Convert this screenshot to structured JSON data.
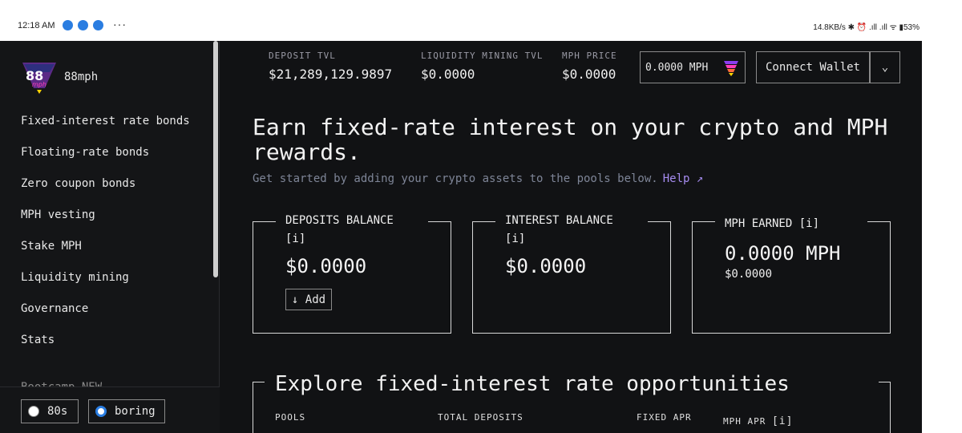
{
  "status_bar": {
    "time": "12:18 AM",
    "more": "···",
    "right": "14.8KB/s ✱ ⏰ .ıll .ıll ᯤ ▮53%"
  },
  "sidebar": {
    "brand": "88mph",
    "items": [
      {
        "label": "Fixed-interest rate bonds"
      },
      {
        "label": "Floating-rate bonds"
      },
      {
        "label": "Zero coupon bonds"
      },
      {
        "label": "MPH vesting"
      },
      {
        "label": "Stake MPH"
      },
      {
        "label": "Liquidity mining"
      },
      {
        "label": "Governance"
      },
      {
        "label": "Stats"
      }
    ],
    "cut_item": "Bootcamp NEW",
    "themes": [
      {
        "label": "80s",
        "selected": false
      },
      {
        "label": "boring",
        "selected": true
      }
    ]
  },
  "header": {
    "deposit_tvl_label": "DEPOSIT TVL",
    "deposit_tvl_value": "$21,289,129.9897",
    "lm_tvl_label": "LIQUIDITY MINING TVL",
    "lm_tvl_value": "$0.0000",
    "mph_price_label": "MPH PRICE",
    "mph_price_value": "$0.0000",
    "mph_balance": "0.0000 MPH",
    "connect_label": "Connect Wallet",
    "dropdown_icon": "⌄"
  },
  "hero": {
    "headline": "Earn fixed-rate interest on your crypto and MPH rewards.",
    "subtitle": "Get started by adding your crypto assets to the pools below.",
    "help_label": "Help",
    "help_icon": "↗"
  },
  "cards": {
    "deposits": {
      "title": "DEPOSITS BALANCE",
      "info": "[i]",
      "value": "$0.0000",
      "add_label": "↓ Add"
    },
    "interest": {
      "title": "INTEREST BALANCE",
      "info": "[i]",
      "value": "$0.0000"
    },
    "mph": {
      "title": "MPH EARNED",
      "info": "[i]",
      "value": "0.0000 MPH",
      "sub_value": "$0.0000"
    }
  },
  "explore": {
    "title": "Explore fixed-interest rate opportunities",
    "columns": [
      "POOLS",
      "TOTAL DEPOSITS",
      "FIXED APR",
      "MPH APR"
    ],
    "mph_apr_info": "[i]"
  },
  "colors": {
    "background": "#111214",
    "sidebar_bg": "#141517",
    "muted_text": "#9a9aa5",
    "help_link": "#a68cf0",
    "radio_selected": "#2a7de1"
  }
}
